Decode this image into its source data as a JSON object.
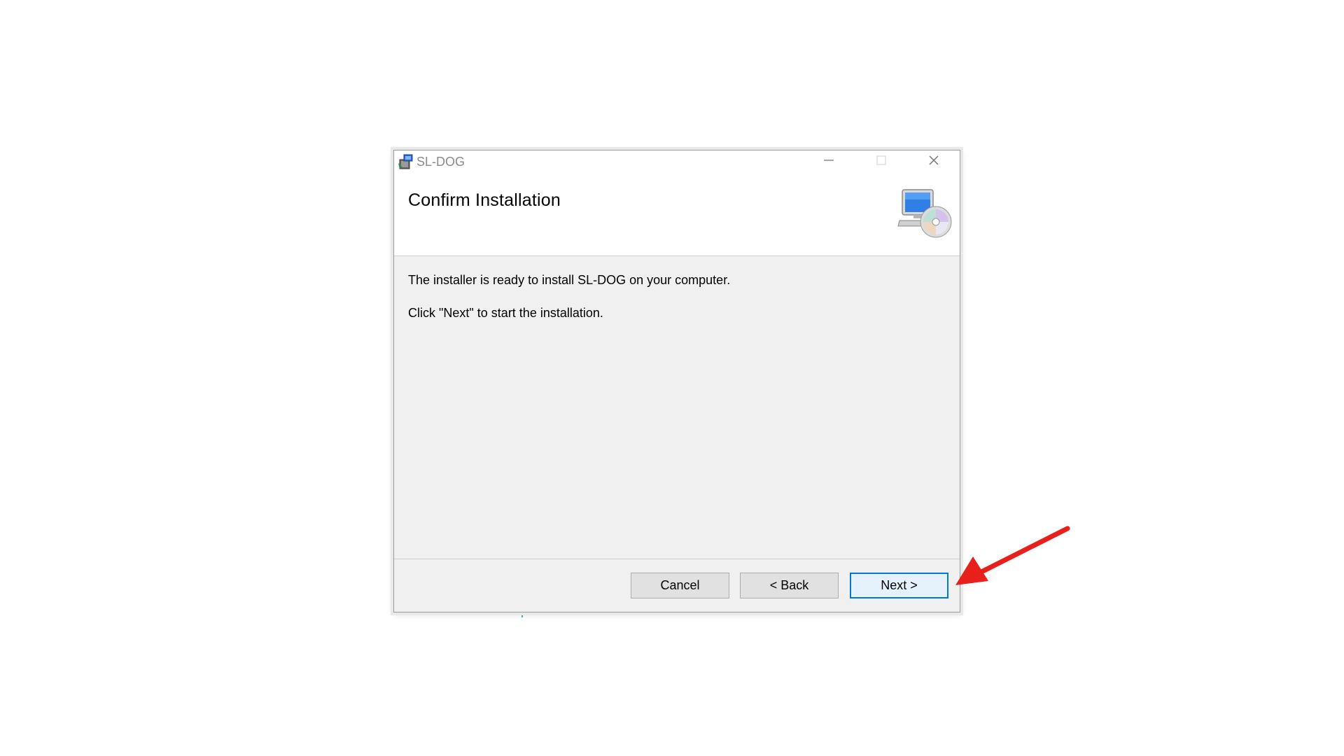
{
  "window": {
    "title": "SL-DOG",
    "controls": {
      "minimize": "minimize-icon",
      "maximize": "maximize-icon",
      "close": "close-icon"
    }
  },
  "header": {
    "title": "Confirm Installation",
    "icon": "computer-cd-icon"
  },
  "body": {
    "line1": "The installer is ready to install SL-DOG on your computer.",
    "line2": "Click \"Next\" to start the installation."
  },
  "buttons": {
    "cancel": "Cancel",
    "back": "< Back",
    "next": "Next >"
  },
  "annotation": {
    "arrow_color": "#e8201c",
    "target": "next-button"
  },
  "colors": {
    "accent": "#0078d7"
  }
}
